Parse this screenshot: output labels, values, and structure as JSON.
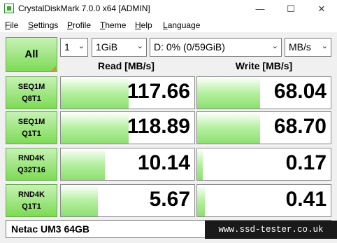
{
  "window": {
    "title": "CrystalDiskMark 7.0.0 x64 [ADMIN]",
    "minimize": "—",
    "maximize": "☐",
    "close": "✕"
  },
  "menu": [
    {
      "mnemonic": "F",
      "rest": "ile"
    },
    {
      "mnemonic": "S",
      "rest": "ettings"
    },
    {
      "mnemonic": "P",
      "rest": "rofile"
    },
    {
      "mnemonic": "T",
      "rest": "heme"
    },
    {
      "mnemonic": "H",
      "rest": "elp"
    },
    {
      "mnemonic": "L",
      "rest": "anguage"
    }
  ],
  "controls": {
    "all_label": "All",
    "test_count": "1",
    "test_size": "1GiB",
    "drive": "D: 0% (0/59GiB)",
    "unit": "MB/s"
  },
  "headers": {
    "read": "Read [MB/s]",
    "write": "Write [MB/s]"
  },
  "rows": [
    {
      "line1": "SEQ1M",
      "line2": "Q8T1",
      "read": "117.66",
      "write": "68.04",
      "read_fill": 0.51,
      "write_fill": 0.47
    },
    {
      "line1": "SEQ1M",
      "line2": "Q1T1",
      "read": "118.89",
      "write": "68.70",
      "read_fill": 0.51,
      "write_fill": 0.47
    },
    {
      "line1": "RND4K",
      "line2": "Q32T16",
      "read": "10.14",
      "write": "0.17",
      "read_fill": 0.33,
      "write_fill": 0.04
    },
    {
      "line1": "RND4K",
      "line2": "Q1T1",
      "read": "5.67",
      "write": "0.41",
      "read_fill": 0.28,
      "write_fill": 0.06
    }
  ],
  "comment": "Netac UM3 64GB",
  "watermark": "www.ssd-tester.co.uk",
  "colors": {
    "bar_fill": "#8ddf70",
    "button_green": "#7ddb55",
    "corner_orange": "#e98b2a"
  }
}
